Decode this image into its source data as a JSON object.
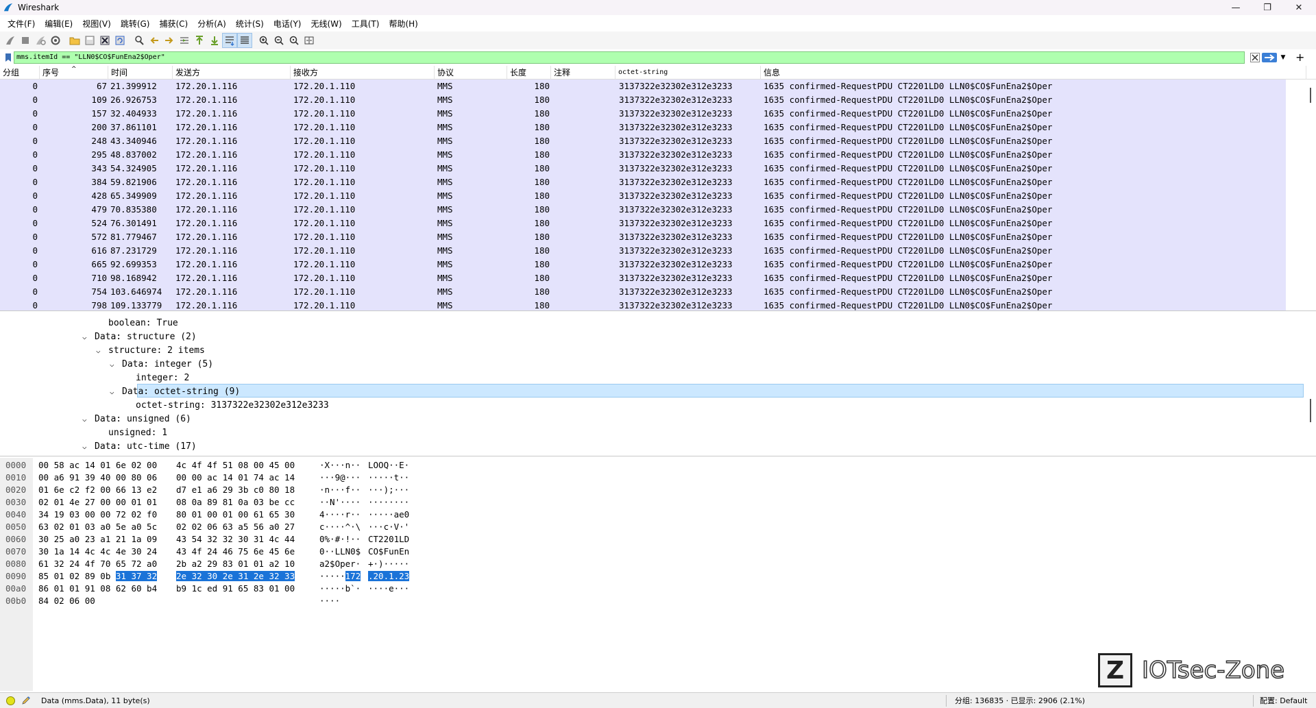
{
  "window": {
    "title": "Wireshark"
  },
  "menu": [
    "文件(F)",
    "编辑(E)",
    "视图(V)",
    "跳转(G)",
    "捕获(C)",
    "分析(A)",
    "统计(S)",
    "电话(Y)",
    "无线(W)",
    "工具(T)",
    "帮助(H)"
  ],
  "filter": {
    "value": "mms.itemId == \"LLN0$CO$FunEna2$Oper\""
  },
  "packet_list": {
    "columns": [
      "分组",
      "序号",
      "时间",
      "发送方",
      "接收方",
      "协议",
      "长度",
      "注释",
      "octet-string",
      "信息"
    ],
    "rows": [
      {
        "group": "0",
        "no": "67",
        "time": "21.399912",
        "src": "172.20.1.116",
        "dst": "172.20.1.110",
        "proto": "MMS",
        "len": "180",
        "octet": "3137322e32302e312e3233",
        "info": "1635 confirmed-RequestPDU CT2201LD0 LLN0$CO$FunEna2$Oper"
      },
      {
        "group": "0",
        "no": "109",
        "time": "26.926753",
        "src": "172.20.1.116",
        "dst": "172.20.1.110",
        "proto": "MMS",
        "len": "180",
        "octet": "3137322e32302e312e3233",
        "info": "1635 confirmed-RequestPDU CT2201LD0 LLN0$CO$FunEna2$Oper"
      },
      {
        "group": "0",
        "no": "157",
        "time": "32.404933",
        "src": "172.20.1.116",
        "dst": "172.20.1.110",
        "proto": "MMS",
        "len": "180",
        "octet": "3137322e32302e312e3233",
        "info": "1635 confirmed-RequestPDU CT2201LD0 LLN0$CO$FunEna2$Oper"
      },
      {
        "group": "0",
        "no": "200",
        "time": "37.861101",
        "src": "172.20.1.116",
        "dst": "172.20.1.110",
        "proto": "MMS",
        "len": "180",
        "octet": "3137322e32302e312e3233",
        "info": "1635 confirmed-RequestPDU CT2201LD0 LLN0$CO$FunEna2$Oper"
      },
      {
        "group": "0",
        "no": "248",
        "time": "43.340946",
        "src": "172.20.1.116",
        "dst": "172.20.1.110",
        "proto": "MMS",
        "len": "180",
        "octet": "3137322e32302e312e3233",
        "info": "1635 confirmed-RequestPDU CT2201LD0 LLN0$CO$FunEna2$Oper"
      },
      {
        "group": "0",
        "no": "295",
        "time": "48.837002",
        "src": "172.20.1.116",
        "dst": "172.20.1.110",
        "proto": "MMS",
        "len": "180",
        "octet": "3137322e32302e312e3233",
        "info": "1635 confirmed-RequestPDU CT2201LD0 LLN0$CO$FunEna2$Oper"
      },
      {
        "group": "0",
        "no": "343",
        "time": "54.324905",
        "src": "172.20.1.116",
        "dst": "172.20.1.110",
        "proto": "MMS",
        "len": "180",
        "octet": "3137322e32302e312e3233",
        "info": "1635 confirmed-RequestPDU CT2201LD0 LLN0$CO$FunEna2$Oper"
      },
      {
        "group": "0",
        "no": "384",
        "time": "59.821906",
        "src": "172.20.1.116",
        "dst": "172.20.1.110",
        "proto": "MMS",
        "len": "180",
        "octet": "3137322e32302e312e3233",
        "info": "1635 confirmed-RequestPDU CT2201LD0 LLN0$CO$FunEna2$Oper"
      },
      {
        "group": "0",
        "no": "428",
        "time": "65.349909",
        "src": "172.20.1.116",
        "dst": "172.20.1.110",
        "proto": "MMS",
        "len": "180",
        "octet": "3137322e32302e312e3233",
        "info": "1635 confirmed-RequestPDU CT2201LD0 LLN0$CO$FunEna2$Oper"
      },
      {
        "group": "0",
        "no": "479",
        "time": "70.835380",
        "src": "172.20.1.116",
        "dst": "172.20.1.110",
        "proto": "MMS",
        "len": "180",
        "octet": "3137322e32302e312e3233",
        "info": "1635 confirmed-RequestPDU CT2201LD0 LLN0$CO$FunEna2$Oper"
      },
      {
        "group": "0",
        "no": "524",
        "time": "76.301491",
        "src": "172.20.1.116",
        "dst": "172.20.1.110",
        "proto": "MMS",
        "len": "180",
        "octet": "3137322e32302e312e3233",
        "info": "1635 confirmed-RequestPDU CT2201LD0 LLN0$CO$FunEna2$Oper"
      },
      {
        "group": "0",
        "no": "572",
        "time": "81.779467",
        "src": "172.20.1.116",
        "dst": "172.20.1.110",
        "proto": "MMS",
        "len": "180",
        "octet": "3137322e32302e312e3233",
        "info": "1635 confirmed-RequestPDU CT2201LD0 LLN0$CO$FunEna2$Oper"
      },
      {
        "group": "0",
        "no": "616",
        "time": "87.231729",
        "src": "172.20.1.116",
        "dst": "172.20.1.110",
        "proto": "MMS",
        "len": "180",
        "octet": "3137322e32302e312e3233",
        "info": "1635 confirmed-RequestPDU CT2201LD0 LLN0$CO$FunEna2$Oper"
      },
      {
        "group": "0",
        "no": "665",
        "time": "92.699353",
        "src": "172.20.1.116",
        "dst": "172.20.1.110",
        "proto": "MMS",
        "len": "180",
        "octet": "3137322e32302e312e3233",
        "info": "1635 confirmed-RequestPDU CT2201LD0 LLN0$CO$FunEna2$Oper"
      },
      {
        "group": "0",
        "no": "710",
        "time": "98.168942",
        "src": "172.20.1.116",
        "dst": "172.20.1.110",
        "proto": "MMS",
        "len": "180",
        "octet": "3137322e32302e312e3233",
        "info": "1635 confirmed-RequestPDU CT2201LD0 LLN0$CO$FunEna2$Oper"
      },
      {
        "group": "0",
        "no": "754",
        "time": "103.646974",
        "src": "172.20.1.116",
        "dst": "172.20.1.110",
        "proto": "MMS",
        "len": "180",
        "octet": "3137322e32302e312e3233",
        "info": "1635 confirmed-RequestPDU CT2201LD0 LLN0$CO$FunEna2$Oper"
      },
      {
        "group": "0",
        "no": "798",
        "time": "109.133779",
        "src": "172.20.1.116",
        "dst": "172.20.1.110",
        "proto": "MMS",
        "len": "180",
        "octet": "3137322e32302e312e3233",
        "info": "1635 confirmed-RequestPDU CT2201LD0 LLN0$CO$FunEna2$Oper"
      }
    ]
  },
  "details": [
    {
      "level": 5,
      "text": "boolean: True",
      "expand": ""
    },
    {
      "level": 4,
      "text": "Data: structure (2)",
      "expand": "open"
    },
    {
      "level": 5,
      "text": "structure: 2 items",
      "expand": "open"
    },
    {
      "level": 6,
      "text": "Data: integer (5)",
      "expand": "open"
    },
    {
      "level": 7,
      "text": "integer: 2",
      "expand": ""
    },
    {
      "level": 6,
      "text": "Data: octet-string (9)",
      "expand": "open",
      "selected": true
    },
    {
      "level": 7,
      "text": "octet-string: 3137322e32302e312e3233",
      "expand": ""
    },
    {
      "level": 4,
      "text": "Data: unsigned (6)",
      "expand": "open"
    },
    {
      "level": 5,
      "text": "unsigned: 1",
      "expand": ""
    },
    {
      "level": 4,
      "text": "Data: utc-time (17)",
      "expand": "open"
    }
  ],
  "bytes": [
    {
      "off": "0000",
      "h1": "00 58 ac 14 01 6e 02 00",
      "h2": "4c 4f 4f 51 08 00 45 00",
      "a1": "·X···n··",
      "a2": "LOOQ··E·"
    },
    {
      "off": "0010",
      "h1": "00 a6 91 39 40 00 80 06",
      "h2": "00 00 ac 14 01 74 ac 14",
      "a1": "···9@···",
      "a2": "·····t··"
    },
    {
      "off": "0020",
      "h1": "01 6e c2 f2 00 66 13 e2",
      "h2": "d7 e1 a6 29 3b c0 80 18",
      "a1": "·n···f··",
      "a2": "···);···"
    },
    {
      "off": "0030",
      "h1": "02 01 4e 27 00 00 01 01",
      "h2": "08 0a 89 81 0a 03 be cc",
      "a1": "··N'····",
      "a2": "········"
    },
    {
      "off": "0040",
      "h1": "34 19 03 00 00 72 02 f0",
      "h2": "80 01 00 01 00 61 65 30",
      "a1": "4····r··",
      "a2": "·····ae0"
    },
    {
      "off": "0050",
      "h1": "63 02 01 03 a0 5e a0 5c",
      "h2": "02 02 06 63 a5 56 a0 27",
      "a1": "c····^·\\",
      "a2": "···c·V·'"
    },
    {
      "off": "0060",
      "h1": "30 25 a0 23 a1 21 1a 09",
      "h2": "43 54 32 32 30 31 4c 44",
      "a1": "0%·#·!··",
      "a2": "CT2201LD"
    },
    {
      "off": "0070",
      "h1": "30 1a 14 4c 4c 4e 30 24",
      "h2": "43 4f 24 46 75 6e 45 6e",
      "a1": "0··LLN0$",
      "a2": "CO$FunEn"
    },
    {
      "off": "0080",
      "h1": "61 32 24 4f 70 65 72 a0",
      "h2": "2b a2 29 83 01 01 a2 10",
      "a1": "a2$Oper·",
      "a2": "+·)·····"
    },
    {
      "off": "0090",
      "h1": "85 01 02 89 0b ",
      "h1hl": "31 37 32",
      "h2": "",
      "h2hl": "2e 32 30 2e 31 2e 32 33",
      "a1": "·····",
      "a1hl": "172",
      "a2": "",
      "a2hl": ".20.1.23"
    },
    {
      "off": "00a0",
      "h1": "86 01 01 91 08 62 60 b4",
      "h2": "b9 1c ed 91 65 83 01 00",
      "a1": "·····b`·",
      "a2": "····e···"
    },
    {
      "off": "00b0",
      "h1": "84 02 06 00",
      "h2": "",
      "a1": "····",
      "a2": ""
    }
  ],
  "watermark": {
    "letter": "Z",
    "text": "IOTsec-Zone"
  },
  "status": {
    "field": "Data (mms.Data), 11 byte(s)",
    "packets": "分组: 136835 · 已显示: 2906 (2.1%)",
    "profile": "配置: Default"
  },
  "colors": {
    "row_bg": "#e4e3fc",
    "filter_bg": "#afffaf",
    "selection": "#cce8ff",
    "byte_highlight": "#1a73d8"
  }
}
